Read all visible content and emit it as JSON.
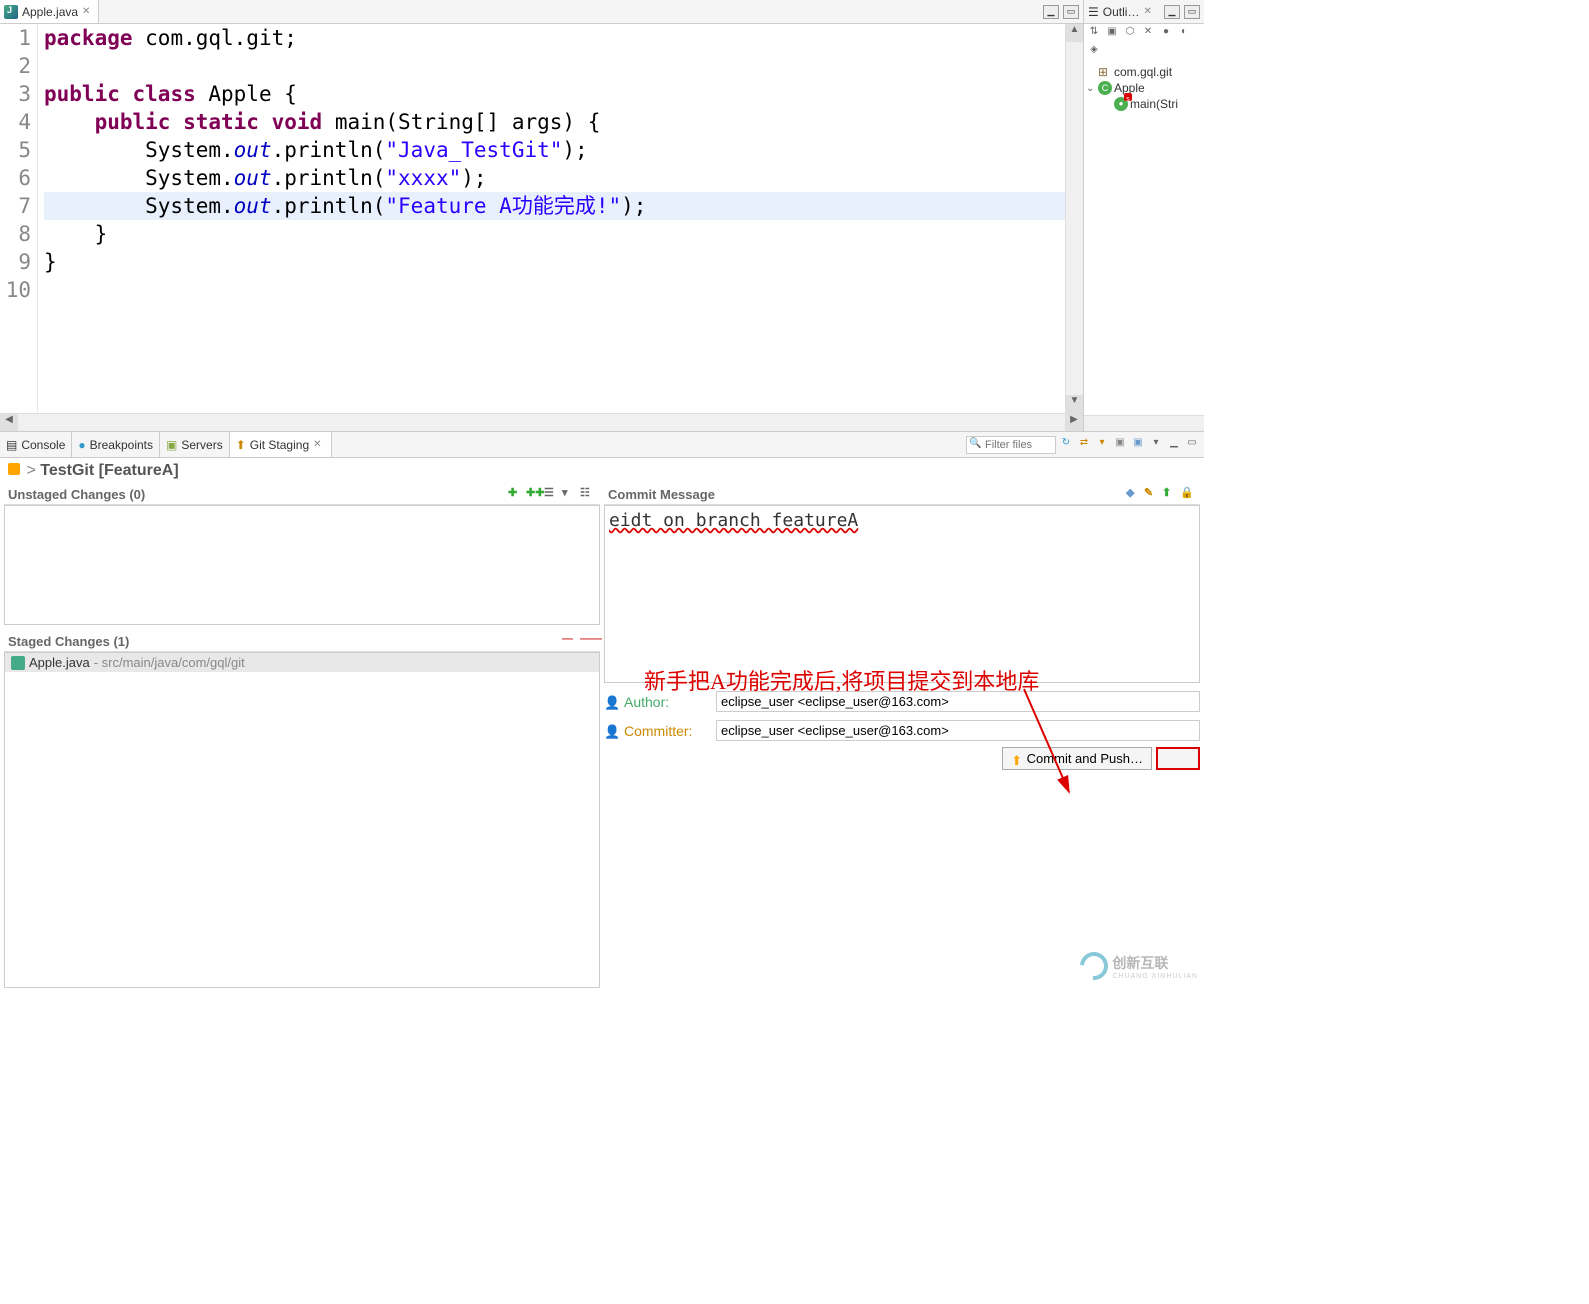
{
  "editor": {
    "tab_title": "Apple.java",
    "lines": [
      {
        "n": 1,
        "segments": [
          [
            "kw",
            "package"
          ],
          [
            "plain",
            " com.gql.git;"
          ]
        ]
      },
      {
        "n": 2,
        "segments": []
      },
      {
        "n": 3,
        "segments": [
          [
            "kw",
            "public"
          ],
          [
            "plain",
            " "
          ],
          [
            "kw",
            "class"
          ],
          [
            "plain",
            " Apple {"
          ]
        ]
      },
      {
        "n": 4,
        "segments": [
          [
            "plain",
            "    "
          ],
          [
            "kw",
            "public"
          ],
          [
            "plain",
            " "
          ],
          [
            "kw",
            "static"
          ],
          [
            "plain",
            " "
          ],
          [
            "kw",
            "void"
          ],
          [
            "plain",
            " main(String[] args) {"
          ]
        ]
      },
      {
        "n": 5,
        "segments": [
          [
            "plain",
            "        System."
          ],
          [
            "field",
            "out"
          ],
          [
            "plain",
            ".println("
          ],
          [
            "str",
            "\"Java_TestGit\""
          ],
          [
            "plain",
            ");"
          ]
        ]
      },
      {
        "n": 6,
        "segments": [
          [
            "plain",
            "        System."
          ],
          [
            "field",
            "out"
          ],
          [
            "plain",
            ".println("
          ],
          [
            "str",
            "\"xxxx\""
          ],
          [
            "plain",
            ");"
          ]
        ]
      },
      {
        "n": 7,
        "highlighted": true,
        "segments": [
          [
            "plain",
            "        System."
          ],
          [
            "field",
            "out"
          ],
          [
            "plain",
            ".println("
          ],
          [
            "str",
            "\"Feature A功能完成!\""
          ],
          [
            "plain",
            ");"
          ]
        ]
      },
      {
        "n": 8,
        "segments": [
          [
            "plain",
            "    }"
          ]
        ]
      },
      {
        "n": 9,
        "segments": [
          [
            "plain",
            "}"
          ]
        ]
      },
      {
        "n": 10,
        "segments": []
      }
    ]
  },
  "outline": {
    "title": "Outli…",
    "package": "com.gql.git",
    "class": "Apple",
    "method": "main(Stri"
  },
  "bottom_tabs": {
    "console": "Console",
    "breakpoints": "Breakpoints",
    "servers": "Servers",
    "git_staging": "Git Staging",
    "filter_placeholder": "Filter files"
  },
  "git": {
    "header_chevron": ">",
    "header_repo": "TestGit",
    "header_branch": "[FeatureA]",
    "unstaged_title": "Unstaged Changes (0)",
    "staged_title": "Staged Changes (1)",
    "staged_file": "Apple.java",
    "staged_path": " - src/main/java/com/gql/git",
    "commit_msg_title": "Commit Message",
    "commit_msg_text": "eidt on branch featureA",
    "author_label": "Author:",
    "committer_label": "Committer:",
    "author_value": "eclipse_user <eclipse_user@163.com>",
    "committer_value": "eclipse_user <eclipse_user@163.com>",
    "commit_push_btn": "Commit and Push…"
  },
  "annotation_text": "新手把A功能完成后,将项目提交到本地库",
  "watermark": "创新互联"
}
